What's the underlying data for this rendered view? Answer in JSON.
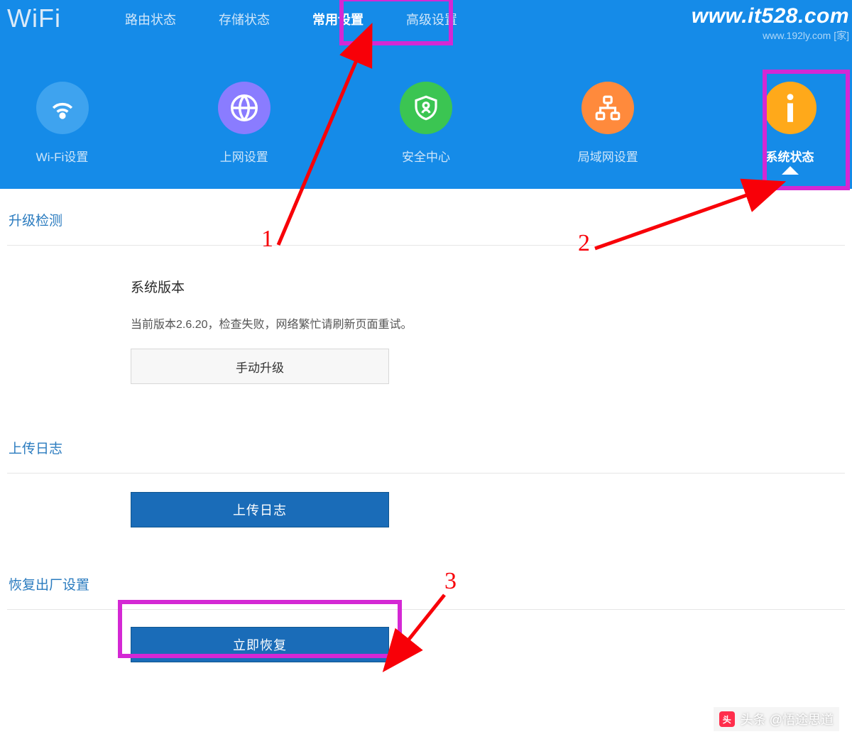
{
  "brand": "WiFi",
  "watermark": {
    "main": "www.it528.com",
    "sub": "www.192ly.com [家]"
  },
  "nav": {
    "items": [
      {
        "label": "路由状态",
        "active": false
      },
      {
        "label": "存储状态",
        "active": false
      },
      {
        "label": "常用设置",
        "active": true
      },
      {
        "label": "高级设置",
        "active": false
      }
    ]
  },
  "iconRow": {
    "items": [
      {
        "label": "Wi-Fi设置",
        "icon": "wifi"
      },
      {
        "label": "上网设置",
        "icon": "globe"
      },
      {
        "label": "安全中心",
        "icon": "shield"
      },
      {
        "label": "局域网设置",
        "icon": "lan"
      },
      {
        "label": "系统状态",
        "icon": "info",
        "active": true
      }
    ]
  },
  "sections": {
    "upgrade": {
      "title": "升级检测",
      "heading": "系统版本",
      "info": "当前版本2.6.20，检查失败，网络繁忙请刷新页面重试。",
      "button": "手动升级"
    },
    "log": {
      "title": "上传日志",
      "button": "上传日志"
    },
    "factory": {
      "title": "恢复出厂设置",
      "button": "立即恢复"
    }
  },
  "annotations": {
    "n1": "1",
    "n2": "2",
    "n3": "3"
  },
  "bottom": {
    "brand": "头条 @悟途思道"
  }
}
